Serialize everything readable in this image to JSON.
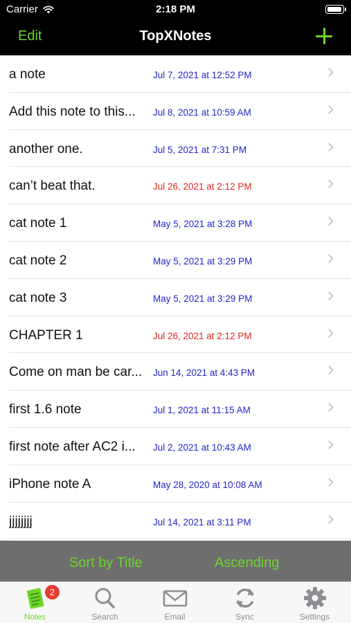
{
  "status_bar": {
    "carrier": "Carrier",
    "time": "2:18 PM"
  },
  "nav": {
    "edit_label": "Edit",
    "title": "TopXNotes"
  },
  "notes": [
    {
      "title": "a note",
      "date": "Jul 7, 2021 at 12:52 PM",
      "highlight": false
    },
    {
      "title": "Add this note to this...",
      "date": "Jul 8, 2021 at 10:59 AM",
      "highlight": false
    },
    {
      "title": "another one.",
      "date": "Jul 5, 2021 at 7:31 PM",
      "highlight": false
    },
    {
      "title": "can’t beat that.",
      "date": "Jul 26, 2021 at 2:12 PM",
      "highlight": true
    },
    {
      "title": "cat note 1",
      "date": "May 5, 2021 at 3:28 PM",
      "highlight": false
    },
    {
      "title": "cat note 2",
      "date": "May 5, 2021 at 3:29 PM",
      "highlight": false
    },
    {
      "title": "cat note 3",
      "date": "May 5, 2021 at 3:29 PM",
      "highlight": false
    },
    {
      "title": "CHAPTER 1",
      "date": "Jul 26, 2021 at 2:12 PM",
      "highlight": true
    },
    {
      "title": "Come on man be car...",
      "date": "Jun 14, 2021 at 4:43 PM",
      "highlight": false
    },
    {
      "title": "first 1.6 note",
      "date": "Jul 1, 2021 at 11:15 AM",
      "highlight": false
    },
    {
      "title": "first note after AC2 i...",
      "date": "Jul 2, 2021 at 10:43 AM",
      "highlight": false
    },
    {
      "title": "iPhone note A",
      "date": "May 28, 2020 at 10:08 AM",
      "highlight": false
    },
    {
      "title": "jjjjjjjj",
      "date": "Jul 14, 2021 at 3:11 PM",
      "highlight": false
    }
  ],
  "sort_bar": {
    "sort_label": "Sort by Title",
    "order_label": "Ascending"
  },
  "tabs": [
    {
      "label": "Notes",
      "icon": "notes-icon",
      "active": true,
      "badge": "2"
    },
    {
      "label": "Search",
      "icon": "search-icon",
      "active": false
    },
    {
      "label": "Email",
      "icon": "email-icon",
      "active": false
    },
    {
      "label": "Sync",
      "icon": "sync-icon",
      "active": false
    },
    {
      "label": "Settings",
      "icon": "gear-icon",
      "active": false
    }
  ],
  "colors": {
    "accent": "#6dd62a",
    "date_blue": "#2424c8",
    "date_red": "#e0251f",
    "badge": "#e63a33",
    "sort_bar_bg": "#6e6e6e"
  }
}
